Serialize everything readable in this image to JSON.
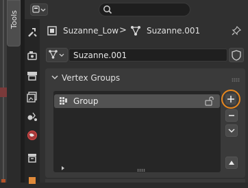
{
  "sidebar_tab": {
    "label": "Tools"
  },
  "header": {
    "search_placeholder": ""
  },
  "breadcrumb": {
    "object_name": "Suzanne_Low",
    "separator": ">",
    "mesh_name": "Suzanne.001"
  },
  "datablock": {
    "name": "Suzanne.001"
  },
  "vertex_groups": {
    "title": "Vertex Groups",
    "items": [
      {
        "name": "Group",
        "locked": false
      }
    ]
  },
  "colors": {
    "highlight_ring": "#e8871e",
    "panel_bg": "#303030",
    "list_bg": "#262626",
    "selected_item": "#525252"
  },
  "icons": {
    "editor_type": "properties-editor-icon",
    "search": "search-icon",
    "pin": "pin-icon",
    "object": "object-icon",
    "mesh": "mesh-data-icon",
    "fake_user": "shield-icon",
    "vertex_group": "vertex-group-icon",
    "lock": "lock-icon",
    "add": "plus-icon",
    "remove": "minus-icon",
    "specials": "chevron-down-icon",
    "move_up": "triangle-up-icon"
  }
}
